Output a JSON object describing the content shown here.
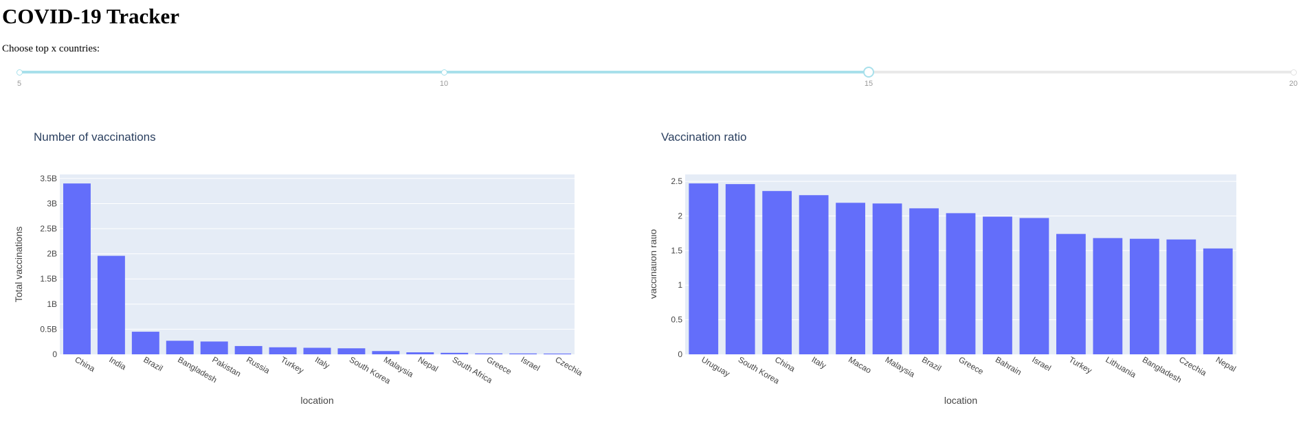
{
  "page": {
    "title": "COVID-19 Tracker"
  },
  "slider": {
    "label": "Choose top x countries:",
    "min": 5,
    "max": 20,
    "value": 15,
    "marks": [
      "5",
      "10",
      "15",
      "20"
    ]
  },
  "colors": {
    "bar": "#636efa",
    "plot_bg": "#e5ecf6",
    "slider_track": "#a8e0eb",
    "text": "#444444",
    "title": "#2a3f5f"
  },
  "chart_data": [
    {
      "type": "bar",
      "title": "Number of vaccinations",
      "xlabel": "location",
      "ylabel": "Total vaccinations",
      "categories": [
        "China",
        "India",
        "Brazil",
        "Bangladesh",
        "Pakistan",
        "Russia",
        "Turkey",
        "Italy",
        "South Korea",
        "Malaysia",
        "Nepal",
        "South Africa",
        "Greece",
        "Israel",
        "Czechia"
      ],
      "values": [
        3400000000,
        1960000000,
        450000000,
        270000000,
        255000000,
        165000000,
        140000000,
        130000000,
        120000000,
        65000000,
        40000000,
        30000000,
        18000000,
        17000000,
        15000000
      ],
      "ylim": [
        0,
        3580000000
      ],
      "yticks": [
        0,
        500000000,
        1000000000,
        1500000000,
        2000000000,
        2500000000,
        3000000000,
        3500000000
      ],
      "ytick_labels": [
        "0",
        "0.5B",
        "1B",
        "1.5B",
        "2B",
        "2.5B",
        "3B",
        "3.5B"
      ],
      "grid": true
    },
    {
      "type": "bar",
      "title": "Vaccination ratio",
      "xlabel": "location",
      "ylabel": "Vaccination ratio",
      "categories": [
        "Uruguay",
        "South Korea",
        "China",
        "Italy",
        "Macao",
        "Malaysia",
        "Brazil",
        "Greece",
        "Bahrain",
        "Israel",
        "Turkey",
        "Lithuania",
        "Bangladesh",
        "Czechia",
        "Nepal"
      ],
      "values": [
        2.47,
        2.46,
        2.36,
        2.3,
        2.19,
        2.18,
        2.11,
        2.04,
        1.99,
        1.97,
        1.74,
        1.68,
        1.67,
        1.66,
        1.53
      ],
      "ylim": [
        0,
        2.6
      ],
      "yticks": [
        0,
        0.5,
        1,
        1.5,
        2,
        2.5
      ],
      "ytick_labels": [
        "0",
        "0.5",
        "1",
        "1.5",
        "2",
        "2.5"
      ],
      "grid": true
    }
  ]
}
